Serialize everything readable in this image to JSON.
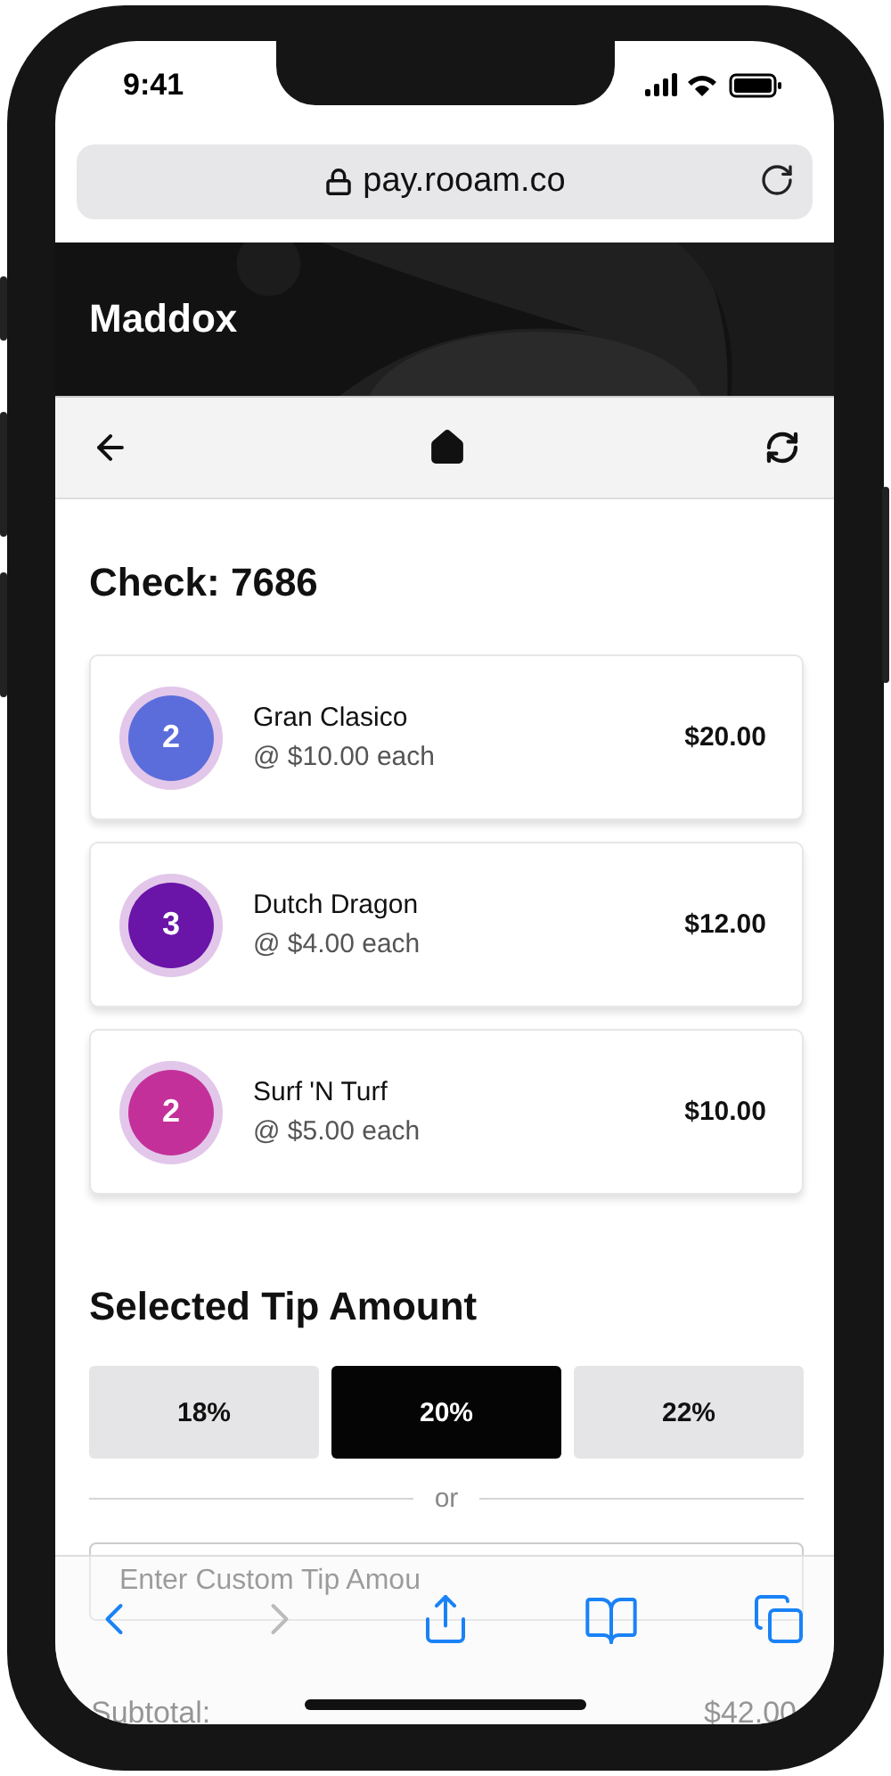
{
  "status_bar": {
    "time": "9:41"
  },
  "browser": {
    "url": "pay.rooam.co"
  },
  "header": {
    "title": "Maddox"
  },
  "check": {
    "title": "Check: 7686"
  },
  "items": [
    {
      "quantity": "2",
      "name": "Gran Clasico",
      "unit_price": "@ $10.00 each",
      "total": "$20.00",
      "color": "#5b6ddb"
    },
    {
      "quantity": "3",
      "name": "Dutch Dragon",
      "unit_price": "@ $4.00 each",
      "total": "$12.00",
      "color": "#6a14a8"
    },
    {
      "quantity": "2",
      "name": "Surf 'N Turf",
      "unit_price": "@ $5.00 each",
      "total": "$10.00",
      "color": "#c4309a"
    }
  ],
  "tip": {
    "title": "Selected Tip Amount",
    "options": [
      {
        "label": "18%",
        "selected": false
      },
      {
        "label": "20%",
        "selected": true
      },
      {
        "label": "22%",
        "selected": false
      }
    ],
    "divider": "or",
    "custom_placeholder": "Enter Custom Tip Amou"
  },
  "summary": {
    "label": "Subtotal:",
    "value": "$42.00"
  },
  "browser_toolbar": {
    "back_disabled": false,
    "forward_disabled": true
  }
}
